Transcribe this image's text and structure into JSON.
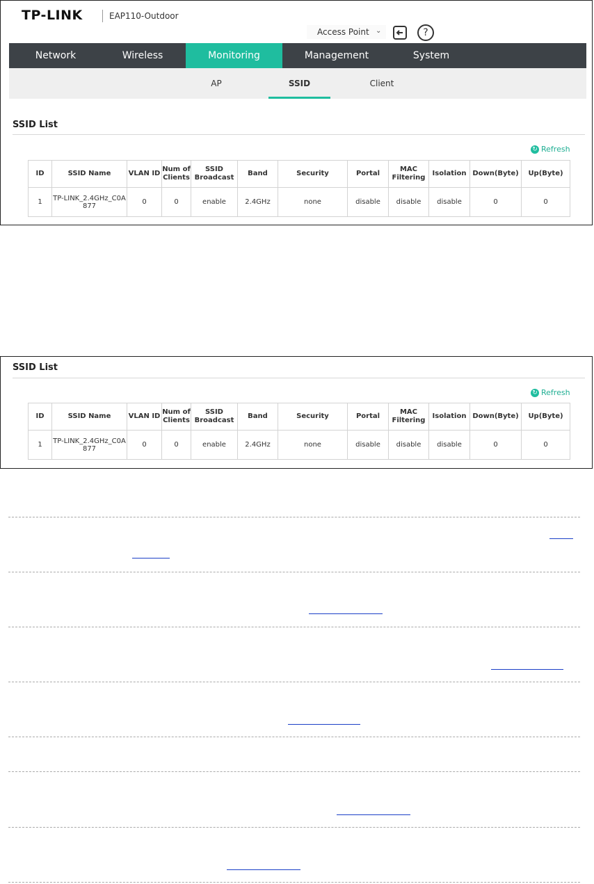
{
  "header": {
    "brand": "TP-LINK",
    "model": "EAP110-Outdoor",
    "mode_select": "Access Point",
    "logout_icon": "logout-icon",
    "help_icon": "help-icon"
  },
  "main_tabs": [
    "Network",
    "Wireless",
    "Monitoring",
    "Management",
    "System"
  ],
  "active_tab": "Monitoring",
  "sub_tabs": [
    "AP",
    "SSID",
    "Client"
  ],
  "active_sub_tab": "SSID",
  "colors": {
    "accent": "#1fbd9f",
    "nav_bg": "#3d4247",
    "subnav_bg": "#efefef",
    "link": "#1a3fc7"
  },
  "ssid_list": {
    "title": "SSID List",
    "refresh_label": "Refresh",
    "columns": [
      "ID",
      "SSID Name",
      "VLAN ID",
      "Num of Clients",
      "SSID Broadcast",
      "Band",
      "Security",
      "Portal",
      "MAC Filtering",
      "Isolation",
      "Down(Byte)",
      "Up(Byte)"
    ],
    "rows": [
      [
        "1",
        "TP-LINK_2.4GHz_C0A877",
        "0",
        "0",
        "enable",
        "2.4GHz",
        "none",
        "disable",
        "disable",
        "disable",
        "0",
        "0"
      ]
    ]
  }
}
